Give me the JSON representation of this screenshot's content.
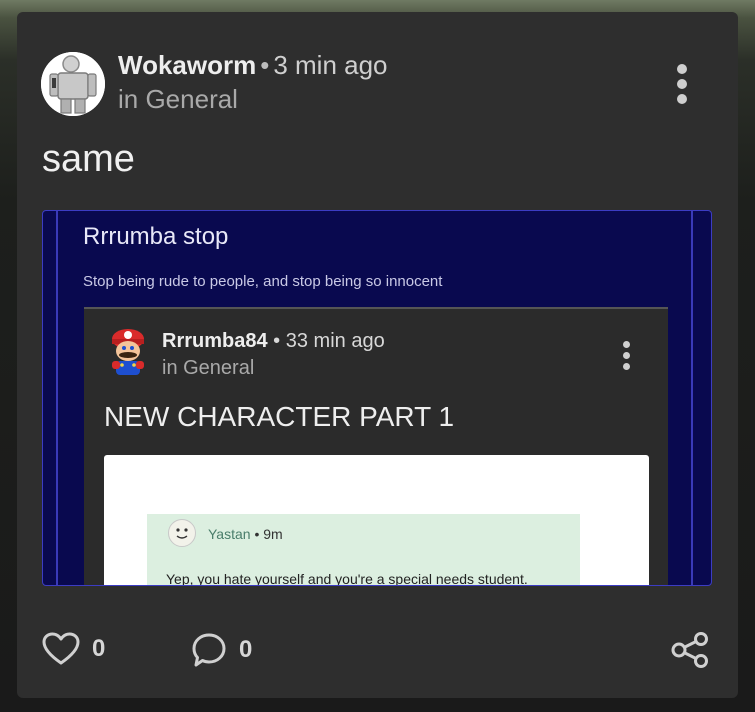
{
  "post": {
    "author": "Wokaworm",
    "separator": "•",
    "time": "3 min ago",
    "category": "in General",
    "body": "same",
    "avatar_icon": "robot-avatar-icon",
    "menu_icon": "more-vertical-icon"
  },
  "embed": {
    "title": "Rrrumba stop",
    "subtitle": "Stop being rude to people, and stop being so innocent",
    "accent_color": "#09094f"
  },
  "inner_post": {
    "author": "Rrrumba84",
    "separator": "•",
    "time": "33 min ago",
    "category": "in General",
    "title": "NEW CHARACTER PART 1",
    "avatar_icon": "mario-avatar-icon"
  },
  "screenshot_comment": {
    "author": "Yastan",
    "separator": "•",
    "time": "9m",
    "text": "Yep, you hate yourself and you're a special needs student."
  },
  "footer": {
    "likes": "0",
    "comments": "0",
    "like_icon": "heart-icon",
    "comment_icon": "speech-bubble-icon",
    "share_icon": "share-icon"
  }
}
